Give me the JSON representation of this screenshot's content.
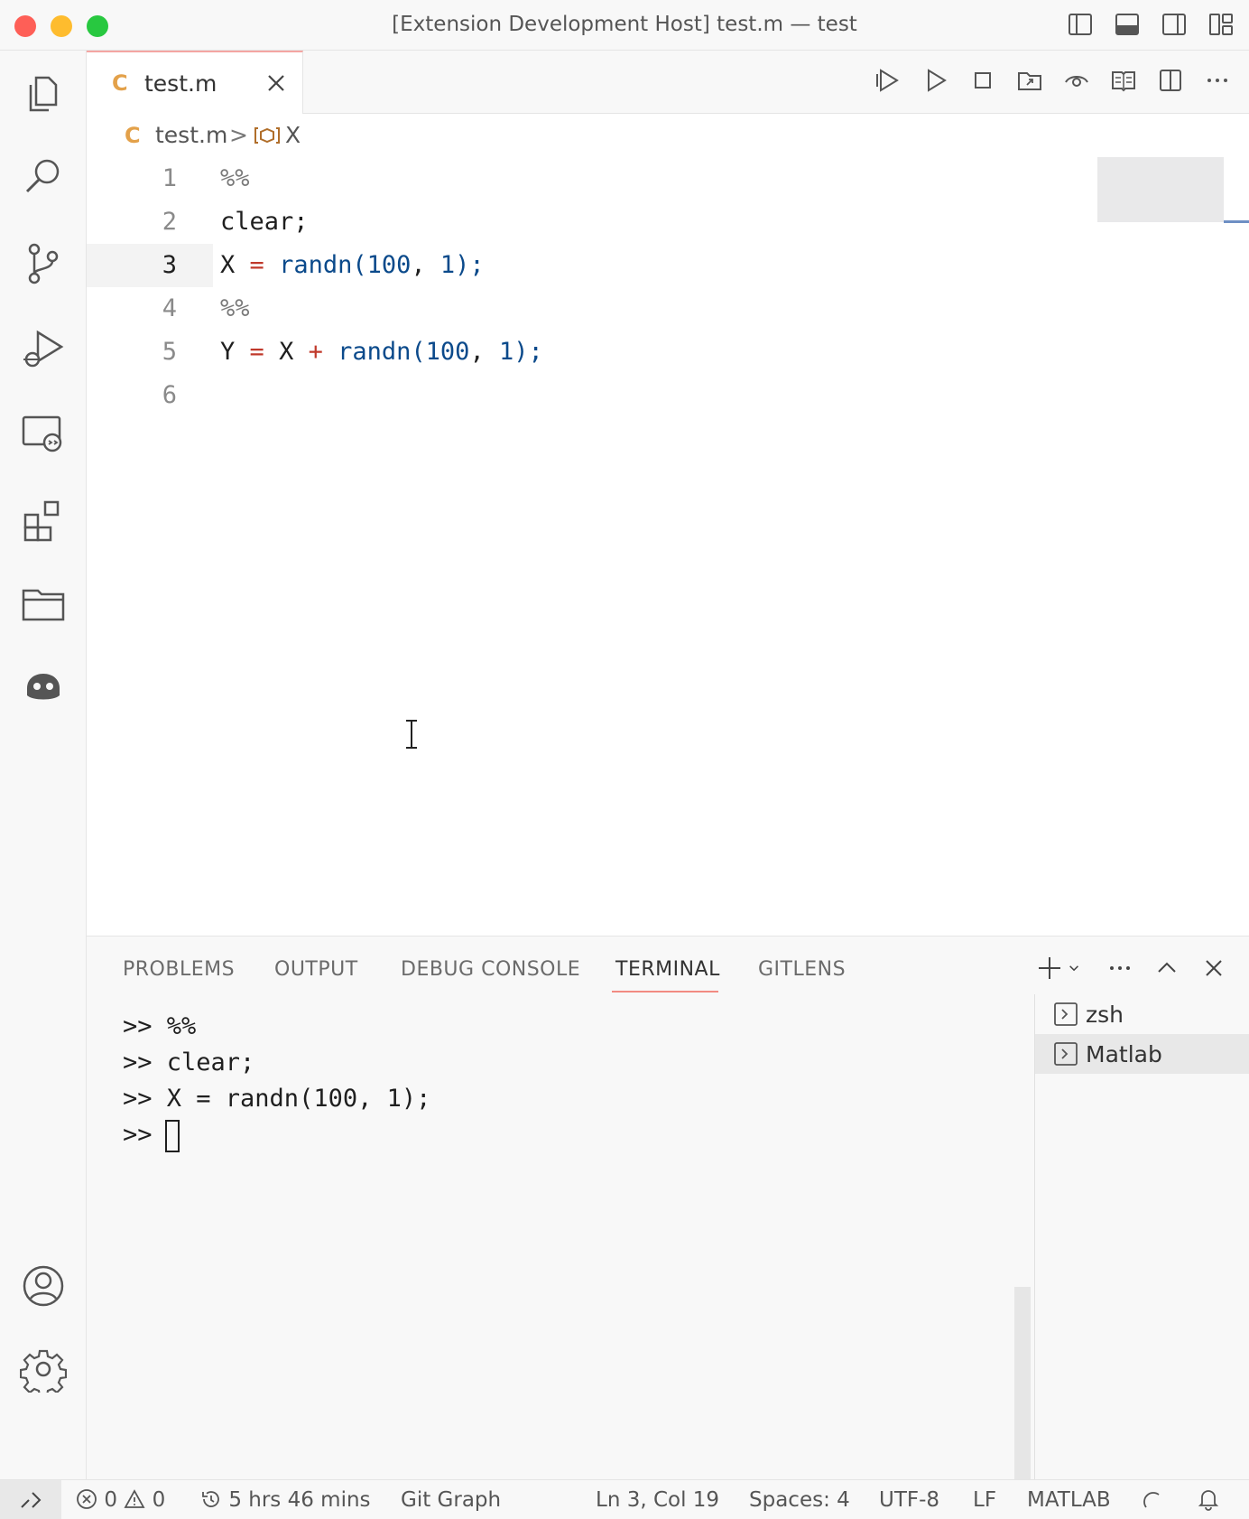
{
  "window": {
    "title": "[Extension Development Host] test.m — test"
  },
  "tab": {
    "icon_letter": "C",
    "label": "test.m"
  },
  "breadcrumb": {
    "icon_letter": "C",
    "file": "test.m",
    "separator": ">",
    "symbol": "X"
  },
  "editor": {
    "lines": [
      {
        "num": "1",
        "text": "%%"
      },
      {
        "num": "2",
        "text": "clear;"
      },
      {
        "num": "3",
        "text": "X = randn(100, 1);"
      },
      {
        "num": "4",
        "text": "%%"
      },
      {
        "num": "5",
        "text": "Y = X + randn(100, 1);"
      },
      {
        "num": "6",
        "text": ""
      }
    ],
    "tokens": {
      "l1": "%%",
      "l2": "clear;",
      "l3_var": "X",
      "l3_eq": "=",
      "l3_fn": "randn(",
      "l3_n1": "100",
      "l3_sep": ", ",
      "l3_n2": "1",
      "l3_end": ");",
      "l4": "%%",
      "l5_var": "Y",
      "l5_eq": "=",
      "l5_x": "X",
      "l5_plus": "+",
      "l5_fn": "randn(",
      "l5_n1": "100",
      "l5_sep": ", ",
      "l5_n2": "1",
      "l5_end": ");"
    }
  },
  "panel": {
    "tabs": [
      "PROBLEMS",
      "OUTPUT",
      "DEBUG CONSOLE",
      "TERMINAL",
      "GITLENS"
    ],
    "active_tab": "TERMINAL",
    "terminal_lines": [
      ">> %%",
      ">> clear;",
      ">> X = randn(100, 1);",
      ">>"
    ],
    "terminals": [
      "zsh",
      "Matlab"
    ],
    "selected_terminal": "Matlab"
  },
  "status": {
    "errors": "0",
    "warnings": "0",
    "time": "5 hrs 46 mins",
    "git_graph": "Git Graph",
    "position": "Ln 3, Col 19",
    "spaces": "Spaces: 4",
    "encoding": "UTF-8",
    "eol": "LF",
    "language": "MATLAB"
  },
  "icons": {
    "activity": [
      "files-icon",
      "search-icon",
      "source-control-icon",
      "run-debug-icon",
      "remote-explorer-icon",
      "extensions-icon",
      "folder-icon",
      "copilot-icon",
      "account-icon",
      "gear-icon"
    ]
  },
  "colors": {
    "accent_tab_border": "#f4a6a2",
    "matlab_icon": "#e3a14a",
    "function": "#0b4a8b",
    "operator": "#c0392b"
  }
}
